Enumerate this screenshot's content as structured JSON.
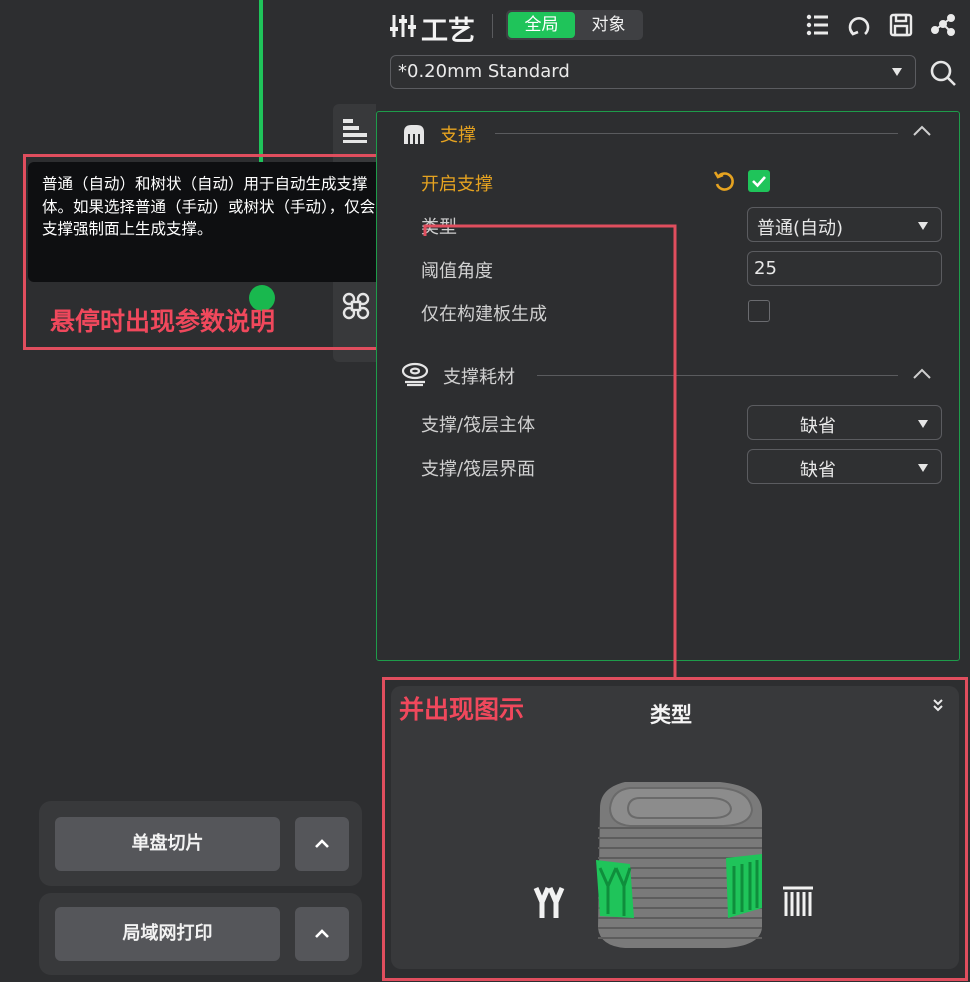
{
  "tooltip": {
    "text": "普通（自动）和树状（自动）用于自动生成支撑体。如果选择普通（手动）或树状（手动），仅会在支撑强制面上生成支撑。"
  },
  "annotations": {
    "hover_caption": "悬停时出现参数说明",
    "diagram_caption": "并出现图示",
    "color": "#f0485c"
  },
  "bottom_controls": {
    "slice_button": "单盘切片",
    "print_button": "局域网打印"
  },
  "header": {
    "title": "工艺",
    "toggle_global": "全局",
    "toggle_object": "对象",
    "icons": [
      "sliders-icon",
      "list-icon",
      "rotate-icon",
      "save-icon",
      "share-icon"
    ]
  },
  "preset": {
    "value": "*0.20mm Standard"
  },
  "support_section": {
    "title": "支撑",
    "rows": {
      "enable": {
        "label": "开启支撑",
        "checked": true
      },
      "type": {
        "label": "类型",
        "value": "普通(自动)"
      },
      "threshold": {
        "label": "阈值角度",
        "value": "25"
      },
      "on_plate_only": {
        "label": "仅在构建板生成",
        "checked": false
      }
    }
  },
  "filament_section": {
    "title": "支撑耗材",
    "rows": {
      "base": {
        "label": "支撑/筏层主体",
        "value": "缺省"
      },
      "interface": {
        "label": "支撑/筏层界面",
        "value": "缺省"
      }
    }
  },
  "diagram": {
    "title": "类型"
  },
  "colors": {
    "accent_green": "#1fc45a",
    "modified_orange": "#e6a320",
    "annotation_red": "#e04e5e",
    "panel_bg": "#2d2e30"
  }
}
